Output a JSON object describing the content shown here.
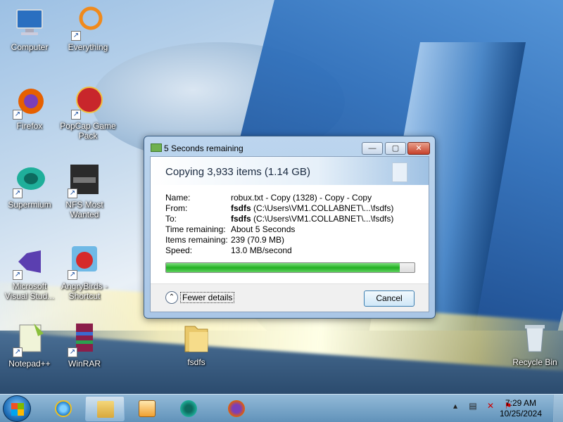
{
  "desktop": {
    "icons": [
      {
        "label": "Computer",
        "icon": "computer-icon"
      },
      {
        "label": "Everything",
        "icon": "everything-icon"
      },
      {
        "label": "Firefox",
        "icon": "firefox-icon"
      },
      {
        "label": "PopCap Game Pack",
        "icon": "popcap-icon"
      },
      {
        "label": "Supermium",
        "icon": "supermium-icon"
      },
      {
        "label": "NFS Most Wanted",
        "icon": "nfs-icon"
      },
      {
        "label": "Microsoft Visual Stud...",
        "icon": "visual-studio-icon"
      },
      {
        "label": "AngryBirds - Shortcut",
        "icon": "angrybirds-icon"
      },
      {
        "label": "Notepad++",
        "icon": "notepadpp-icon"
      },
      {
        "label": "WinRAR",
        "icon": "winrar-icon"
      },
      {
        "label": "fsdfs",
        "icon": "folder-icon"
      },
      {
        "label": "Recycle Bin",
        "icon": "recycle-bin-icon"
      }
    ]
  },
  "dialog": {
    "title": "5 Seconds remaining",
    "header": "Copying 3,933 items (1.14 GB)",
    "name_label": "Name:",
    "name_value": "robux.txt - Copy (1328) - Copy - Copy",
    "from_label": "From:",
    "from_bold": "fsdfs",
    "from_path": " (C:\\Users\\VM1.COLLABNET\\...\\fsdfs)",
    "to_label": "To:",
    "to_bold": "fsdfs",
    "to_path": " (C:\\Users\\VM1.COLLABNET\\...\\fsdfs)",
    "time_label": "Time remaining:",
    "time_value": "About 5 Seconds",
    "items_label": "Items remaining:",
    "items_value": "239 (70.9 MB)",
    "speed_label": "Speed:",
    "speed_value": "13.0 MB/second",
    "progress_fraction": 0.94,
    "fewer_details": "Fewer details",
    "cancel": "Cancel",
    "minimize_glyph": "—",
    "maximize_glyph": "▢",
    "close_glyph": "✕"
  },
  "taskbar": {
    "items": [
      "start-button",
      "internet-explorer",
      "file-explorer",
      "media-player",
      "supermium",
      "firefox"
    ],
    "clock_time": "7:29 AM",
    "clock_date": "10/25/2024",
    "tray_icons": [
      "chevron-up-icon",
      "network-icon",
      "volume-muted-icon",
      "action-center-icon"
    ]
  },
  "colors": {
    "progress": "#23b023",
    "dialog_frame": "#bcd5ee",
    "taskbar": "#7fa8cc"
  }
}
